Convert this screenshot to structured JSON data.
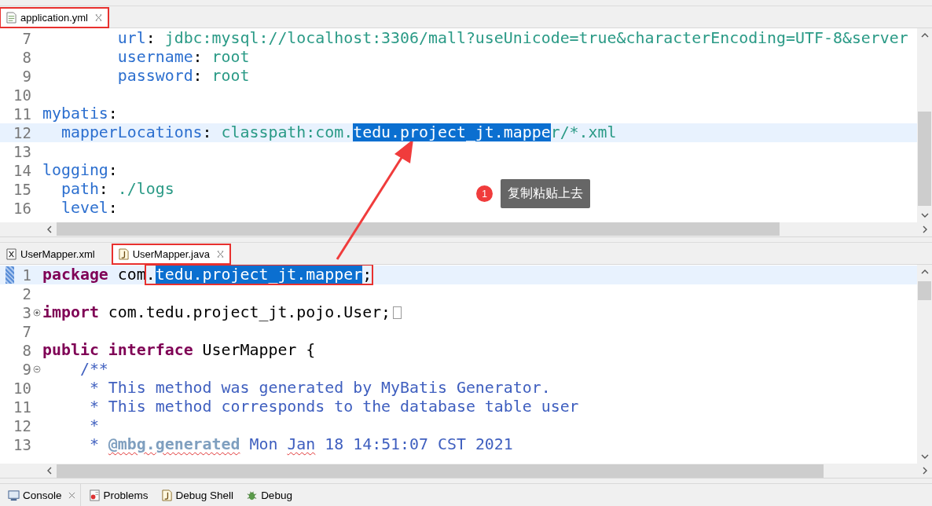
{
  "panes": [
    {
      "tabs": [
        {
          "label": "application.yml",
          "kind": "yml",
          "selected": true,
          "framed": true,
          "closable": true
        }
      ],
      "lines": [
        {
          "number": "7",
          "current": false,
          "tokens": [
            {
              "text": "        url",
              "kind": "key"
            },
            {
              "text": ": ",
              "kind": "plain"
            },
            {
              "text": "jdbc:mysql://localhost:3306/mall?useUnicode=true&characterEncoding=UTF-8&server",
              "kind": "value"
            }
          ]
        },
        {
          "number": "8",
          "current": false,
          "tokens": [
            {
              "text": "        username",
              "kind": "key"
            },
            {
              "text": ": ",
              "kind": "plain"
            },
            {
              "text": "root",
              "kind": "value"
            }
          ]
        },
        {
          "number": "9",
          "current": false,
          "tokens": [
            {
              "text": "        password",
              "kind": "key"
            },
            {
              "text": ": ",
              "kind": "plain"
            },
            {
              "text": "root",
              "kind": "value"
            }
          ]
        },
        {
          "number": "10",
          "current": false
        },
        {
          "number": "11",
          "current": false,
          "tokens": [
            {
              "text": "mybatis",
              "kind": "key"
            },
            {
              "text": ":",
              "kind": "plain"
            }
          ]
        },
        {
          "number": "12",
          "current": true,
          "tokens": [
            {
              "text": "  mapperLocations",
              "kind": "key"
            },
            {
              "text": ": ",
              "kind": "plain"
            },
            {
              "text": "classpath:com.",
              "kind": "value"
            },
            {
              "text": "tedu.project_jt.mappe",
              "kind": "value",
              "selected": true
            },
            {
              "text": "r/*.xml",
              "kind": "value",
              "selected": false
            }
          ]
        },
        {
          "number": "13",
          "current": false
        },
        {
          "number": "14",
          "current": false,
          "tokens": [
            {
              "text": "logging",
              "kind": "key"
            },
            {
              "text": ":",
              "kind": "plain"
            }
          ]
        },
        {
          "number": "15",
          "current": false,
          "tokens": [
            {
              "text": "  path",
              "kind": "key"
            },
            {
              "text": ": ",
              "kind": "plain"
            },
            {
              "text": "./logs",
              "kind": "value"
            }
          ]
        },
        {
          "number": "16",
          "current": false,
          "tokens": [
            {
              "text": "  level",
              "kind": "key"
            },
            {
              "text": ":",
              "kind": "plain"
            }
          ]
        }
      ]
    },
    {
      "tabs": [
        {
          "label": "UserMapper.xml",
          "kind": "xml",
          "selected": false,
          "framed": false,
          "closable": false
        },
        {
          "label": "UserMapper.java",
          "kind": "java",
          "selected": true,
          "framed": true,
          "closable": true
        }
      ],
      "lines": [
        {
          "number": "1",
          "current": true,
          "marker": true,
          "tokens": [
            {
              "text": "package",
              "kind": "keyword"
            },
            {
              "text": " com",
              "kind": "plain"
            },
            {
              "text": ".",
              "kind": "plain",
              "framed": true
            },
            {
              "text": "tedu.project_jt.mapper",
              "kind": "plain",
              "framed": true,
              "selected": true
            },
            {
              "text": ";",
              "kind": "plain",
              "framed": true
            }
          ]
        },
        {
          "number": "2",
          "current": false
        },
        {
          "number": "3",
          "current": false,
          "folded": true,
          "tokens": [
            {
              "text": "import",
              "kind": "keyword"
            },
            {
              "text": " com.tedu.project_jt.pojo.User;",
              "kind": "plain"
            }
          ]
        },
        {
          "number": "7",
          "current": false
        },
        {
          "number": "8",
          "current": false,
          "tokens": [
            {
              "text": "public",
              "kind": "keyword"
            },
            {
              "text": " interface",
              "kind": "keyword"
            },
            {
              "text": " UserMapper {",
              "kind": "plain"
            }
          ]
        },
        {
          "number": "9",
          "current": false,
          "folded": false,
          "tokens": [
            {
              "text": "    /**",
              "kind": "comment"
            }
          ]
        },
        {
          "number": "10",
          "current": false,
          "tokens": [
            {
              "text": "     * This method was generated by MyBatis Generator.",
              "kind": "comment"
            }
          ]
        },
        {
          "number": "11",
          "current": false,
          "tokens": [
            {
              "text": "     * This method corresponds to the database table user",
              "kind": "comment"
            }
          ]
        },
        {
          "number": "12",
          "current": false,
          "tokens": [
            {
              "text": "     *",
              "kind": "comment"
            }
          ]
        },
        {
          "number": "13",
          "current": false,
          "tokens": [
            {
              "text": "     * ",
              "kind": "comment"
            },
            {
              "text": "@mbg.generated",
              "kind": "doctag",
              "misspelled": true
            },
            {
              "text": " Mon ",
              "kind": "comment"
            },
            {
              "text": "Jan",
              "kind": "comment",
              "misspelled": true
            },
            {
              "text": " 18 14:51:07 CST 2021",
              "kind": "comment"
            }
          ]
        }
      ]
    }
  ],
  "bottom_tabs": [
    {
      "label": "Console",
      "kind": "console",
      "selected": true,
      "closable": true
    },
    {
      "label": "Problems",
      "kind": "problems",
      "selected": false,
      "closable": false
    },
    {
      "label": "Debug Shell",
      "kind": "java",
      "selected": false,
      "closable": false
    },
    {
      "label": "Debug",
      "kind": "bug",
      "selected": false,
      "closable": false
    }
  ],
  "callout": {
    "badge": "1",
    "text": "复制粘贴上去"
  }
}
